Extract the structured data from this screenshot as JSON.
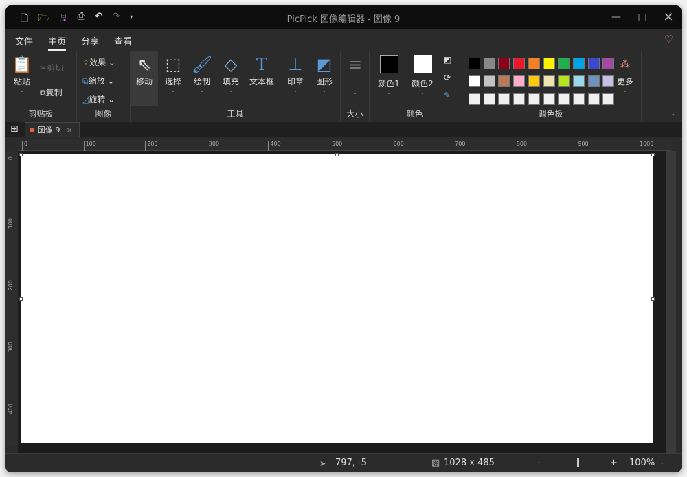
{
  "window": {
    "title": "PicPick 图像编辑器 - 图像 9"
  },
  "menu": {
    "tabs": [
      "文件",
      "主页",
      "分享",
      "查看"
    ],
    "active": 1
  },
  "ribbon": {
    "clipboard": {
      "paste": "粘贴",
      "cut": "剪切",
      "copy": "复制",
      "group": "剪贴板"
    },
    "image": {
      "effects": "效果",
      "resize": "缩放",
      "rotate": "旋转",
      "group": "图像"
    },
    "tools": {
      "items": [
        "移动",
        "选择",
        "绘制",
        "填充",
        "文本框",
        "印章",
        "图形"
      ],
      "group": "工具"
    },
    "size": {
      "group": "大小"
    },
    "color": {
      "color1": "颜色1",
      "color2": "颜色2",
      "group": "颜色",
      "color1_value": "#000000",
      "color2_value": "#ffffff"
    },
    "palette": {
      "group": "调色板",
      "more": "更多",
      "rows": [
        [
          "#000000",
          "#888888",
          "#8b0018",
          "#e8192c",
          "#f98022",
          "#fff200",
          "#1fb04c",
          "#00a2e8",
          "#3f48cc",
          "#a349a4"
        ],
        [
          "#ffffff",
          "#c3c3c3",
          "#b97a57",
          "#ffaec9",
          "#ffc90e",
          "#efe4b0",
          "#b5e61d",
          "#99d9ea",
          "#7092be",
          "#c8bfe7"
        ],
        [
          "#f0f0f0",
          "#f0f0f0",
          "#f0f0f0",
          "#f0f0f0",
          "#f0f0f0",
          "#f0f0f0",
          "#f0f0f0",
          "#f0f0f0",
          "#f0f0f0",
          "#f0f0f0"
        ]
      ]
    }
  },
  "doc_tab": {
    "label": "图像 9",
    "close": "×"
  },
  "rulers": {
    "h": [
      "0",
      "100",
      "200",
      "300",
      "400",
      "500",
      "600",
      "700",
      "800",
      "900",
      "1000"
    ],
    "v": [
      "0",
      "100",
      "200",
      "300",
      "400"
    ]
  },
  "status": {
    "cursor": "797, -5",
    "image_size": "1028 x 485",
    "zoom": "100%",
    "zoom_minus": "-",
    "zoom_plus": "+",
    "zoom_fraction": 0.5
  }
}
